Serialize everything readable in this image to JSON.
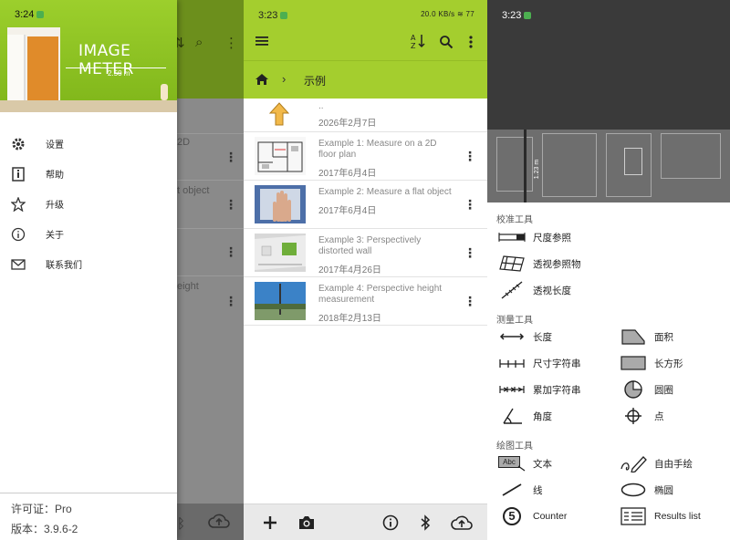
{
  "panel1": {
    "status_time": "3:24",
    "app_logo": "IMAGE METER",
    "header_measure": "2.50 m",
    "menu": [
      {
        "icon": "gear-icon",
        "label": "设置"
      },
      {
        "icon": "help-icon",
        "label": "帮助"
      },
      {
        "icon": "star-icon",
        "label": "升级"
      },
      {
        "icon": "info-icon",
        "label": "关于"
      },
      {
        "icon": "mail-icon",
        "label": "联系我们"
      }
    ],
    "license": "许可证：Pro",
    "version": "版本：3.9.6-2",
    "behind_texts": [
      "2D",
      "t object",
      "eight"
    ]
  },
  "panel2": {
    "status_time": "3:23",
    "status_right": "20.0 KB/s  ≋ 77",
    "breadcrumb_label": "示例",
    "parent_row": {
      "title": "..",
      "date": "2026年2月7日"
    },
    "items": [
      {
        "title": "Example 1: Measure on a 2D floor plan",
        "date": "2017年6月4日"
      },
      {
        "title": "Example 2: Measure a flat object",
        "date": "2017年6月4日"
      },
      {
        "title": "Example 3: Perspectively distorted wall",
        "date": "2017年4月26日"
      },
      {
        "title": "Example 4: Perspective height measurement",
        "date": "2018年2月13日"
      }
    ]
  },
  "panel3": {
    "status_time": "3:23",
    "plan_measure": "1.23 m",
    "sections": {
      "calibration": "校准工具",
      "measure": "测量工具",
      "drawing": "绘图工具"
    },
    "calibration_tools": [
      "尺度参照",
      "透视参照物",
      "透视长度"
    ],
    "measure_tools_left": [
      "长度",
      "尺寸字符串",
      "累加字符串",
      "角度"
    ],
    "measure_tools_right": [
      "面积",
      "长方形",
      "圆圈",
      "点"
    ],
    "drawing_tools_left": [
      "文本",
      "线",
      "Counter"
    ],
    "drawing_tools_right": [
      "自由手绘",
      "椭圆",
      "Results list"
    ],
    "text_icon_label": "Abc",
    "counter_icon_label": "5"
  }
}
